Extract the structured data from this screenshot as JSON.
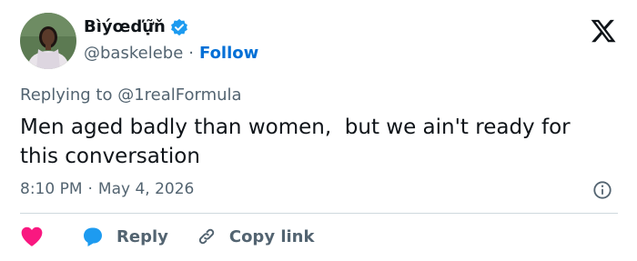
{
  "author": {
    "display_name": "Bìýœďự̃ň",
    "handle": "@baskelebe",
    "separator": "·",
    "follow_label": "Follow",
    "verified": true
  },
  "reply_context": {
    "prefix": "Replying to ",
    "target_handle": "@1realFormula"
  },
  "tweet": {
    "text": "Men aged badly than women,  but we ain't ready for this conversation",
    "time": "8:10 PM",
    "separator": "·",
    "date": "May 4, 2026"
  },
  "actions": {
    "like_icon": "heart-icon",
    "reply_label": "Reply",
    "copy_link_label": "Copy link"
  },
  "colors": {
    "accent": "#006fd6",
    "like": "#f91880",
    "reply_bubble": "#1d9bf0",
    "secondary_text": "#536471",
    "primary_text": "#0f1419",
    "divider": "#cfd9de"
  }
}
